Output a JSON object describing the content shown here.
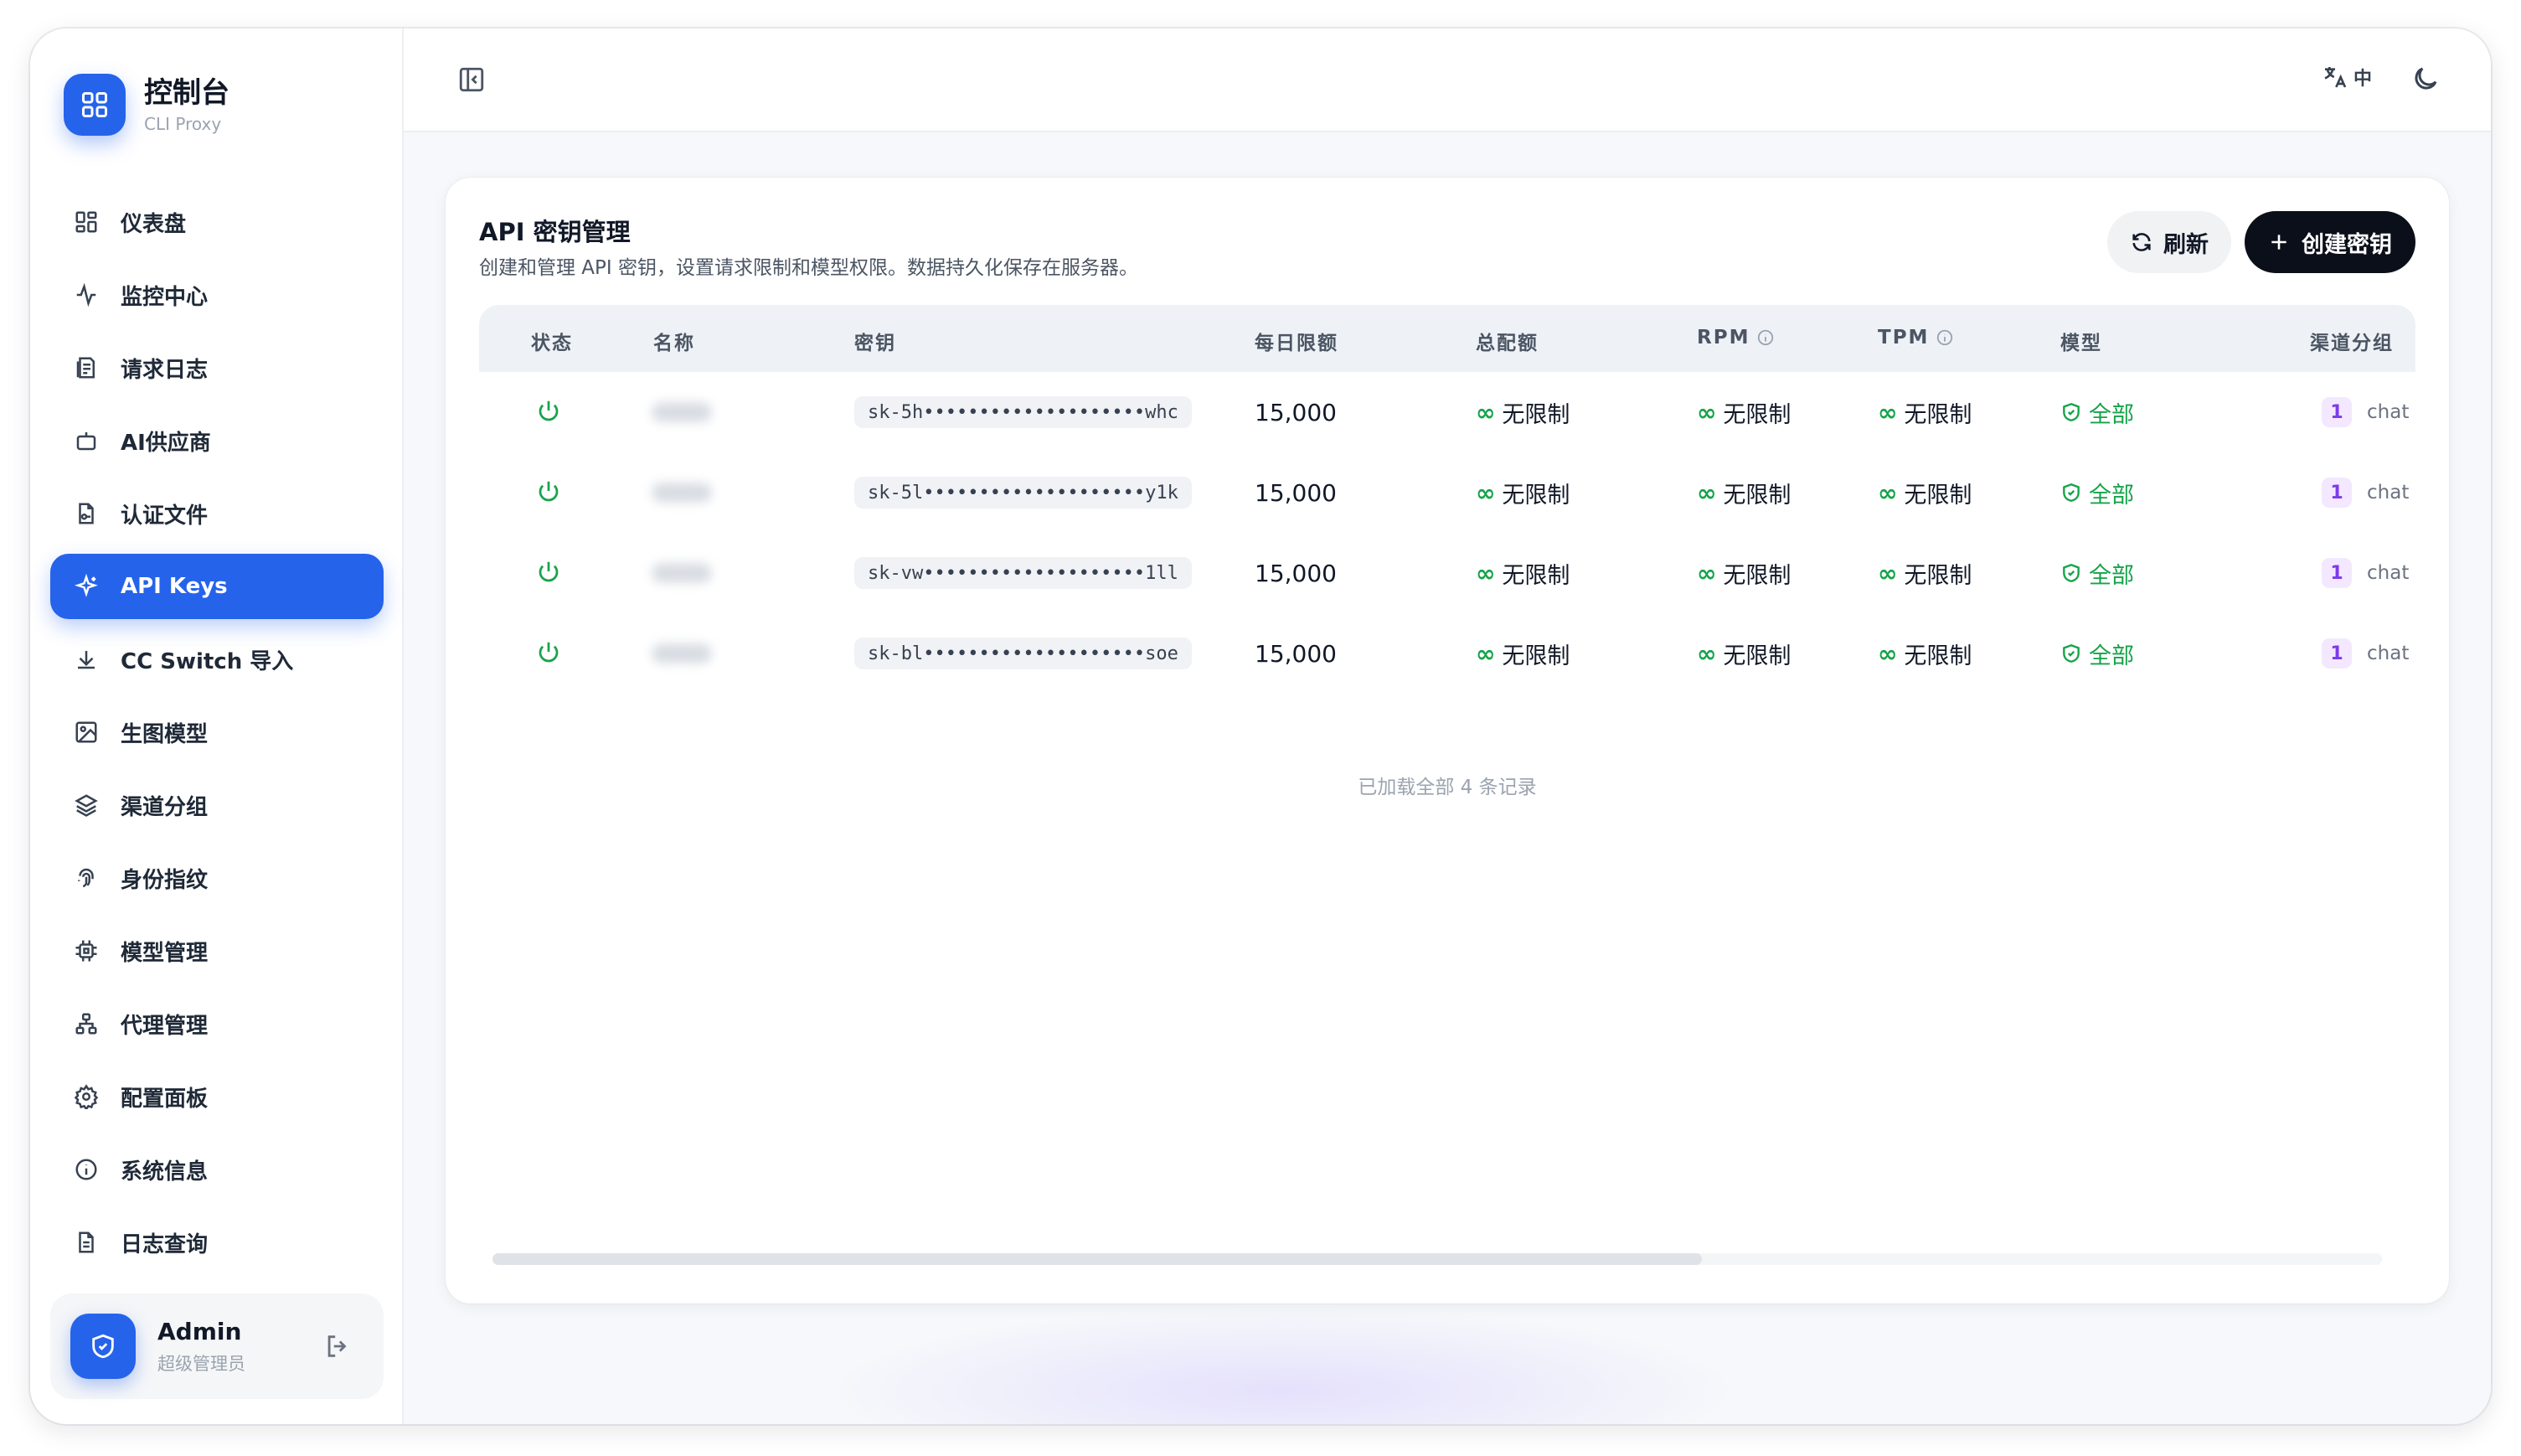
{
  "brand": {
    "title": "控制台",
    "subtitle": "CLI Proxy"
  },
  "sidebar": {
    "items": [
      {
        "label": "仪表盘",
        "icon": "dashboard-icon"
      },
      {
        "label": "监控中心",
        "icon": "activity-icon"
      },
      {
        "label": "请求日志",
        "icon": "log-icon"
      },
      {
        "label": "AI供应商",
        "icon": "bot-icon"
      },
      {
        "label": "认证文件",
        "icon": "file-key-icon"
      },
      {
        "label": "API Keys",
        "icon": "sparkle-icon",
        "active": true
      },
      {
        "label": "CC Switch 导入",
        "icon": "download-icon"
      },
      {
        "label": "生图模型",
        "icon": "image-icon"
      },
      {
        "label": "渠道分组",
        "icon": "layers-icon"
      },
      {
        "label": "身份指纹",
        "icon": "fingerprint-icon"
      },
      {
        "label": "模型管理",
        "icon": "cpu-icon"
      },
      {
        "label": "代理管理",
        "icon": "network-icon"
      },
      {
        "label": "配置面板",
        "icon": "gear-icon"
      },
      {
        "label": "系统信息",
        "icon": "info-icon"
      },
      {
        "label": "日志查询",
        "icon": "document-icon"
      }
    ]
  },
  "user": {
    "name": "Admin",
    "role": "超级管理员"
  },
  "topbar": {
    "lang": "中"
  },
  "card": {
    "title": "API 密钥管理",
    "description": "创建和管理 API 密钥，设置请求限制和模型权限。数据持久化保存在服务器。",
    "refresh_label": "刷新",
    "create_label": "创建密钥"
  },
  "table": {
    "columns": [
      "状态",
      "名称",
      "密钥",
      "每日限额",
      "总配额",
      "RPM",
      "TPM",
      "模型",
      "渠道分组"
    ],
    "rows": [
      {
        "key": "sk-5h••••••••••••••••••••whc",
        "daily": "15,000",
        "total": "无限制",
        "rpm": "无限制",
        "tpm": "无限制",
        "model": "全部",
        "channel_count": "1",
        "channel": "chat"
      },
      {
        "key": "sk-5l••••••••••••••••••••y1k",
        "daily": "15,000",
        "total": "无限制",
        "rpm": "无限制",
        "tpm": "无限制",
        "model": "全部",
        "channel_count": "1",
        "channel": "chat"
      },
      {
        "key": "sk-vw••••••••••••••••••••1ll",
        "daily": "15,000",
        "total": "无限制",
        "rpm": "无限制",
        "tpm": "无限制",
        "model": "全部",
        "channel_count": "1",
        "channel": "chat"
      },
      {
        "key": "sk-bl••••••••••••••••••••soe",
        "daily": "15,000",
        "total": "无限制",
        "rpm": "无限制",
        "tpm": "无限制",
        "model": "全部",
        "channel_count": "1",
        "channel": "chat"
      }
    ],
    "footnote": "已加载全部 4 条记录",
    "scroll_fraction": 0.64
  },
  "colors": {
    "accent": "#2563eb",
    "success": "#16a34a",
    "badge": "#7c3aed"
  }
}
